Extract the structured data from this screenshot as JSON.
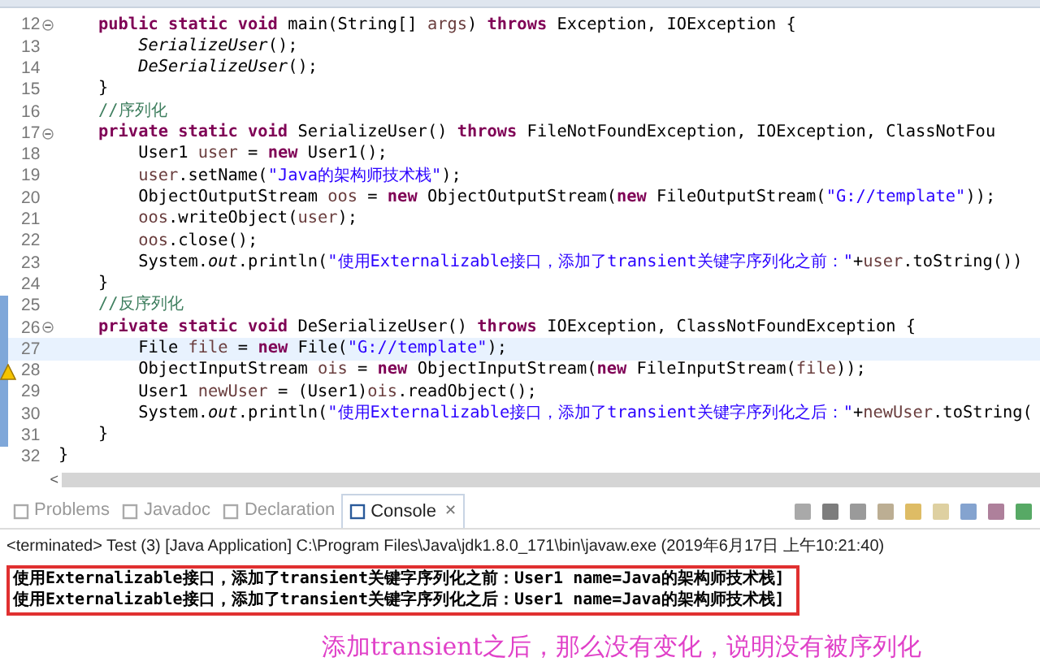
{
  "editor": {
    "lines": [
      {
        "number": "12",
        "foldable": true,
        "current": false,
        "changed": false,
        "warning": false,
        "tokens": [
          {
            "kind": "kw",
            "text": "    public static void"
          },
          {
            "kind": "plain",
            "text": " main(String[] "
          },
          {
            "kind": "var",
            "text": "args"
          },
          {
            "kind": "plain",
            "text": ") "
          },
          {
            "kind": "kw",
            "text": "throws"
          },
          {
            "kind": "plain",
            "text": " Exception, IOException {"
          }
        ]
      },
      {
        "number": "13",
        "foldable": false,
        "current": false,
        "changed": false,
        "warning": false,
        "tokens": [
          {
            "kind": "static",
            "text": "        SerializeUser"
          },
          {
            "kind": "plain",
            "text": "();"
          }
        ]
      },
      {
        "number": "14",
        "foldable": false,
        "current": false,
        "changed": false,
        "warning": false,
        "tokens": [
          {
            "kind": "static",
            "text": "        DeSerializeUser"
          },
          {
            "kind": "plain",
            "text": "();"
          }
        ]
      },
      {
        "number": "15",
        "foldable": false,
        "current": false,
        "changed": false,
        "warning": false,
        "tokens": [
          {
            "kind": "plain",
            "text": "    }"
          }
        ]
      },
      {
        "number": "16",
        "foldable": false,
        "current": false,
        "changed": false,
        "warning": false,
        "tokens": [
          {
            "kind": "comment",
            "text": "    //序列化"
          }
        ]
      },
      {
        "number": "17",
        "foldable": true,
        "current": false,
        "changed": false,
        "warning": false,
        "tokens": [
          {
            "kind": "kw",
            "text": "    private static void"
          },
          {
            "kind": "plain",
            "text": " SerializeUser() "
          },
          {
            "kind": "kw",
            "text": "throws"
          },
          {
            "kind": "plain",
            "text": " FileNotFoundException, IOException, ClassNotFou"
          }
        ]
      },
      {
        "number": "18",
        "foldable": false,
        "current": false,
        "changed": false,
        "warning": false,
        "tokens": [
          {
            "kind": "plain",
            "text": "        User1 "
          },
          {
            "kind": "var",
            "text": "user"
          },
          {
            "kind": "plain",
            "text": " = "
          },
          {
            "kind": "kw",
            "text": "new"
          },
          {
            "kind": "plain",
            "text": " User1();"
          }
        ]
      },
      {
        "number": "19",
        "foldable": false,
        "current": false,
        "changed": false,
        "warning": false,
        "tokens": [
          {
            "kind": "var",
            "text": "        user"
          },
          {
            "kind": "plain",
            "text": ".setName("
          },
          {
            "kind": "string",
            "text": "\"Java的架构师技术栈\""
          },
          {
            "kind": "plain",
            "text": ");"
          }
        ]
      },
      {
        "number": "20",
        "foldable": false,
        "current": false,
        "changed": false,
        "warning": false,
        "tokens": [
          {
            "kind": "plain",
            "text": "        ObjectOutputStream "
          },
          {
            "kind": "var",
            "text": "oos"
          },
          {
            "kind": "plain",
            "text": " = "
          },
          {
            "kind": "kw",
            "text": "new"
          },
          {
            "kind": "plain",
            "text": " ObjectOutputStream("
          },
          {
            "kind": "kw",
            "text": "new"
          },
          {
            "kind": "plain",
            "text": " FileOutputStream("
          },
          {
            "kind": "string",
            "text": "\"G://template\""
          },
          {
            "kind": "plain",
            "text": "));"
          }
        ]
      },
      {
        "number": "21",
        "foldable": false,
        "current": false,
        "changed": false,
        "warning": false,
        "tokens": [
          {
            "kind": "var",
            "text": "        oos"
          },
          {
            "kind": "plain",
            "text": ".writeObject("
          },
          {
            "kind": "var",
            "text": "user"
          },
          {
            "kind": "plain",
            "text": ");"
          }
        ]
      },
      {
        "number": "22",
        "foldable": false,
        "current": false,
        "changed": false,
        "warning": false,
        "tokens": [
          {
            "kind": "var",
            "text": "        oos"
          },
          {
            "kind": "plain",
            "text": ".close();"
          }
        ]
      },
      {
        "number": "23",
        "foldable": false,
        "current": false,
        "changed": false,
        "warning": false,
        "tokens": [
          {
            "kind": "plain",
            "text": "        System."
          },
          {
            "kind": "static",
            "text": "out"
          },
          {
            "kind": "plain",
            "text": ".println("
          },
          {
            "kind": "string",
            "text": "\"使用Externalizable接口，添加了transient关键字序列化之前：\""
          },
          {
            "kind": "plain",
            "text": "+"
          },
          {
            "kind": "var",
            "text": "user"
          },
          {
            "kind": "plain",
            "text": ".toString())"
          }
        ]
      },
      {
        "number": "24",
        "foldable": false,
        "current": false,
        "changed": false,
        "warning": false,
        "tokens": [
          {
            "kind": "plain",
            "text": "    }"
          }
        ]
      },
      {
        "number": "25",
        "foldable": false,
        "current": false,
        "changed": true,
        "warning": false,
        "tokens": [
          {
            "kind": "comment",
            "text": "    //反序列化"
          }
        ]
      },
      {
        "number": "26",
        "foldable": true,
        "current": false,
        "changed": true,
        "warning": false,
        "tokens": [
          {
            "kind": "kw",
            "text": "    private static void"
          },
          {
            "kind": "plain",
            "text": " DeSerializeUser() "
          },
          {
            "kind": "kw",
            "text": "throws"
          },
          {
            "kind": "plain",
            "text": " IOException, ClassNotFoundException {"
          }
        ]
      },
      {
        "number": "27",
        "foldable": false,
        "current": true,
        "changed": true,
        "warning": false,
        "tokens": [
          {
            "kind": "plain",
            "text": "        File "
          },
          {
            "kind": "var",
            "text": "file"
          },
          {
            "kind": "plain",
            "text": " = "
          },
          {
            "kind": "kw",
            "text": "new"
          },
          {
            "kind": "plain",
            "text": " File("
          },
          {
            "kind": "string",
            "text": "\"G://template\""
          },
          {
            "kind": "plain",
            "text": ");"
          }
        ]
      },
      {
        "number": "28",
        "foldable": false,
        "current": false,
        "changed": true,
        "warning": true,
        "tokens": [
          {
            "kind": "plain",
            "text": "        ObjectInputStream "
          },
          {
            "kind": "var",
            "text": "ois"
          },
          {
            "kind": "plain",
            "text": " = "
          },
          {
            "kind": "kw",
            "text": "new"
          },
          {
            "kind": "plain",
            "text": " ObjectInputStream("
          },
          {
            "kind": "kw",
            "text": "new"
          },
          {
            "kind": "plain",
            "text": " FileInputStream("
          },
          {
            "kind": "var",
            "text": "file"
          },
          {
            "kind": "plain",
            "text": "));"
          }
        ]
      },
      {
        "number": "29",
        "foldable": false,
        "current": false,
        "changed": true,
        "warning": false,
        "tokens": [
          {
            "kind": "plain",
            "text": "        User1 "
          },
          {
            "kind": "var",
            "text": "newUser"
          },
          {
            "kind": "plain",
            "text": " = (User1)"
          },
          {
            "kind": "var",
            "text": "ois"
          },
          {
            "kind": "plain",
            "text": ".readObject();"
          }
        ]
      },
      {
        "number": "30",
        "foldable": false,
        "current": false,
        "changed": true,
        "warning": false,
        "tokens": [
          {
            "kind": "plain",
            "text": "        System."
          },
          {
            "kind": "static",
            "text": "out"
          },
          {
            "kind": "plain",
            "text": ".println("
          },
          {
            "kind": "string",
            "text": "\"使用Externalizable接口，添加了transient关键字序列化之后：\""
          },
          {
            "kind": "plain",
            "text": "+"
          },
          {
            "kind": "var",
            "text": "newUser"
          },
          {
            "kind": "plain",
            "text": ".toString("
          }
        ]
      },
      {
        "number": "31",
        "foldable": false,
        "current": false,
        "changed": true,
        "warning": false,
        "tokens": [
          {
            "kind": "plain",
            "text": "    }"
          }
        ]
      },
      {
        "number": "32",
        "foldable": false,
        "current": false,
        "changed": false,
        "warning": false,
        "tokens": [
          {
            "kind": "plain",
            "text": "}"
          }
        ]
      }
    ],
    "scroll_glyph": "<"
  },
  "console": {
    "tabs": [
      {
        "label": "Problems",
        "selected": false
      },
      {
        "label": "Javadoc",
        "selected": false
      },
      {
        "label": "Declaration",
        "selected": false
      },
      {
        "label": "Console",
        "selected": true,
        "close_glyph": "✕"
      }
    ],
    "status": "<terminated> Test (3) [Java Application] C:\\Program Files\\Java\\jdk1.8.0_171\\bin\\javaw.exe (2019年6月17日 上午10:21:40)",
    "output": [
      "使用Externalizable接口，添加了transient关键字序列化之前：User1 name=Java的架构师技术栈]",
      "使用Externalizable接口，添加了transient关键字序列化之后：User1 name=Java的架构师技术栈]"
    ],
    "annotation": "添加transient之后，那么没有变化，说明没有被序列化"
  }
}
